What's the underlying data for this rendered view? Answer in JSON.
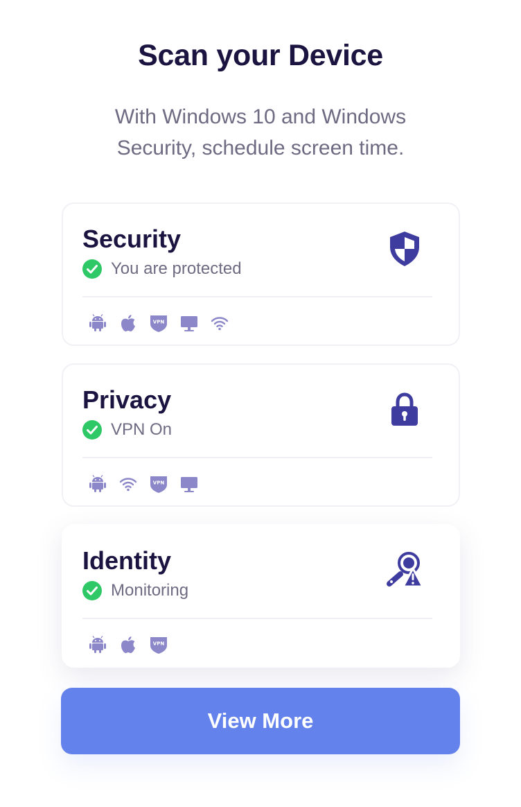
{
  "header": {
    "title": "Scan your Device",
    "subtitle_line1": "With Windows 10 and Windows",
    "subtitle_line2": "Security, schedule screen time."
  },
  "cards": [
    {
      "title": "Security",
      "status": "You are protected",
      "icon": "shield-icon",
      "platform_icons": [
        "android-icon",
        "apple-icon",
        "vpn-icon",
        "desktop-icon",
        "wifi-icon"
      ]
    },
    {
      "title": "Privacy",
      "status": "VPN On",
      "icon": "lock-icon",
      "platform_icons": [
        "android-icon",
        "wifi-icon",
        "vpn-icon",
        "desktop-icon"
      ]
    },
    {
      "title": "Identity",
      "status": "Monitoring",
      "icon": "identity-search-alert-icon",
      "platform_icons": [
        "android-icon",
        "apple-icon",
        "vpn-icon"
      ]
    }
  ],
  "vpn_badge_text": "VPN",
  "button": {
    "label": "View More"
  },
  "colors": {
    "heading": "#1b1340",
    "body_text": "#6e6a82",
    "accent": "#3f3c9f",
    "platform_icon": "#8b87c9",
    "check": "#2ec866",
    "button": "#6482ec"
  }
}
